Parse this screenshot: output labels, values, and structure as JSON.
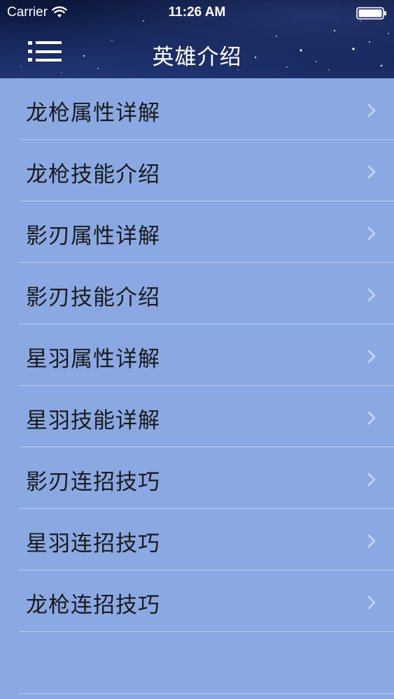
{
  "status_bar": {
    "carrier": "Carrier",
    "time": "11:26 AM"
  },
  "nav": {
    "title": "英雄介绍",
    "menu_icon": "menu-list-icon"
  },
  "colors": {
    "list_background": "#8aa9e3",
    "header_background": "#142454",
    "divider": "#b8caee",
    "chevron": "#c9d6f0"
  },
  "menu": {
    "items": [
      {
        "label": "龙枪属性详解"
      },
      {
        "label": "龙枪技能介绍"
      },
      {
        "label": "影刃属性详解"
      },
      {
        "label": "影刃技能介绍"
      },
      {
        "label": "星羽属性详解"
      },
      {
        "label": "星羽技能详解"
      },
      {
        "label": "影刃连招技巧"
      },
      {
        "label": "星羽连招技巧"
      },
      {
        "label": "龙枪连招技巧"
      }
    ]
  }
}
